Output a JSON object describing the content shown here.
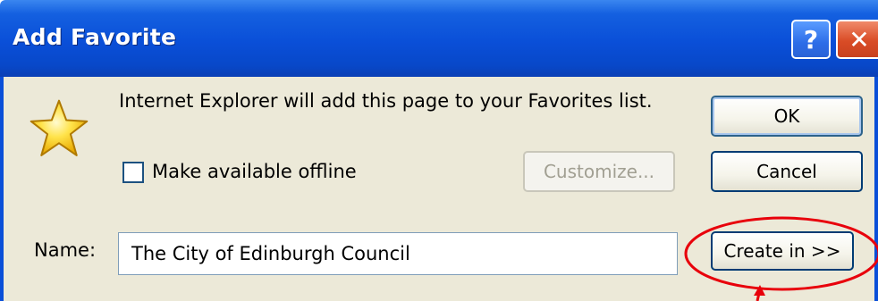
{
  "window": {
    "title": "Add Favorite",
    "help_glyph": "?",
    "close_glyph": "✕"
  },
  "dialog": {
    "message": "Internet Explorer will add this page to your Favorites list.",
    "offline_label": "Make available offline",
    "offline_checked": false,
    "customize_label": "Customize...",
    "ok_label": "OK",
    "cancel_label": "Cancel",
    "name_label": "Name:",
    "name_value": "The City of Edinburgh Council",
    "create_in_label": "Create in >>"
  },
  "icons": {
    "favorite": "star-icon",
    "help": "help-icon",
    "close": "close-icon"
  },
  "colors": {
    "titlebar": "#0a4fd8",
    "dialog_bg": "#ece9d8",
    "close_red": "#d94c26",
    "annotation_red": "#e8000b"
  }
}
